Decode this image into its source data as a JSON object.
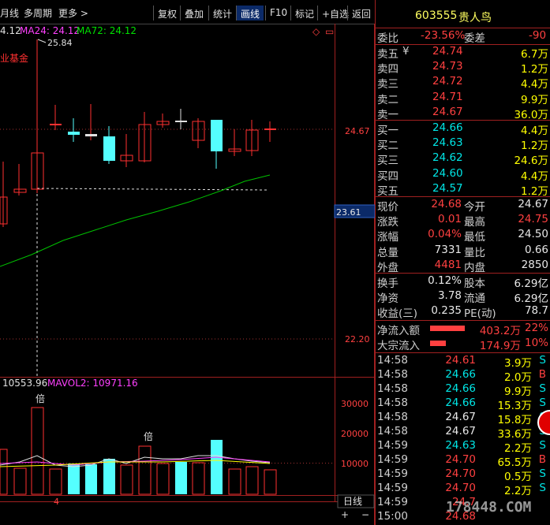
{
  "toolbar": {
    "period_partial": "月线",
    "multi_period": "多周期",
    "more": "更多 >",
    "buttons": [
      "复权",
      "叠加",
      "统计",
      "画线",
      "F10",
      "标记",
      "+自选",
      "返回"
    ],
    "active_button": "画线"
  },
  "chart": {
    "ma_legend": {
      "first_partial": "4.12",
      "ma24": "MA24: 24.12",
      "ma72": "MA72: 24.12"
    },
    "high_marker": "25.84",
    "left_text_partial": "业基金",
    "price_labels": {
      "right_price": "24.67",
      "ma_value_box": "23.61",
      "low_tick": "22.20"
    },
    "volume": {
      "legend_partial": "10553.96",
      "mavol2": "MAVOL2: 10971.16",
      "y_ticks": [
        "30000",
        "20000",
        "10000"
      ],
      "bei_label": "倍"
    },
    "bottom": {
      "axis_label": "4",
      "period_button": "日线"
    },
    "colors": {
      "up": "#ff3030",
      "down": "#54ffff",
      "ma_green": "#00c000",
      "ma_white": "#e0e0e0",
      "ma_yellow": "#ffff00"
    }
  },
  "quote": {
    "header": {
      "code": "603555",
      "name": "贵人鸟"
    },
    "weibi": {
      "label": "委比",
      "value": "-23.56%",
      "label2": "委差",
      "value2": "-90"
    },
    "asks": [
      {
        "label": "卖五",
        "mark": "¥",
        "price": "24.74",
        "vol": "6.7万"
      },
      {
        "label": "卖四",
        "mark": "",
        "price": "24.73",
        "vol": "1.2万"
      },
      {
        "label": "卖三",
        "mark": "",
        "price": "24.72",
        "vol": "4.4万"
      },
      {
        "label": "卖二",
        "mark": "",
        "price": "24.71",
        "vol": "9.9万"
      },
      {
        "label": "卖一",
        "mark": "",
        "price": "24.67",
        "vol": "36.0万"
      }
    ],
    "bids": [
      {
        "label": "买一",
        "price": "24.66",
        "vol": "4.4万"
      },
      {
        "label": "买二",
        "price": "24.63",
        "vol": "1.2万"
      },
      {
        "label": "买三",
        "price": "24.62",
        "vol": "24.6万"
      },
      {
        "label": "买四",
        "price": "24.60",
        "vol": "4.4万"
      },
      {
        "label": "买五",
        "price": "24.57",
        "vol": "1.2万"
      }
    ],
    "stats1": [
      {
        "l1": "现价",
        "v1": "24.68",
        "c1": "red",
        "l2": "今开",
        "v2": "24.67",
        "c2": "white"
      },
      {
        "l1": "涨跌",
        "v1": "0.01",
        "c1": "red",
        "l2": "最高",
        "v2": "24.75",
        "c2": "red"
      },
      {
        "l1": "涨幅",
        "v1": "0.04%",
        "c1": "red",
        "l2": "最低",
        "v2": "24.50",
        "c2": "white"
      },
      {
        "l1": "总量",
        "v1": "7331",
        "c1": "white",
        "l2": "量比",
        "v2": "0.66",
        "c2": "white"
      },
      {
        "l1": "外盘",
        "v1": "4481",
        "c1": "red",
        "l2": "内盘",
        "v2": "2850",
        "c2": "white"
      }
    ],
    "stats2": [
      {
        "l1": "换手",
        "v1": "0.12%",
        "l2": "股本",
        "v2": "6.29亿"
      },
      {
        "l1": "净资",
        "v1": "3.78",
        "l2": "流通",
        "v2": "6.29亿"
      },
      {
        "l1": "收益(三)",
        "v1": "0.235",
        "l2": "PE(动)",
        "v2": "78.7"
      }
    ],
    "flows": [
      {
        "label": "净流入额",
        "value": "403.2万",
        "pct": "22%",
        "bar_ratio": 1.0
      },
      {
        "label": "大宗流入",
        "value": "174.9万",
        "pct": "10%",
        "bar_ratio": 0.45
      }
    ],
    "ticks": [
      {
        "time": "14:58",
        "price": "24.61",
        "pc": "red",
        "vol": "3.9万",
        "flag": "S"
      },
      {
        "time": "14:58",
        "price": "24.66",
        "pc": "green",
        "vol": "2.0万",
        "flag": "B"
      },
      {
        "time": "14:58",
        "price": "24.66",
        "pc": "green",
        "vol": "9.9万",
        "flag": "S"
      },
      {
        "time": "14:58",
        "price": "24.66",
        "pc": "green",
        "vol": "15.3万",
        "flag": "S"
      },
      {
        "time": "14:58",
        "price": "24.67",
        "pc": "white",
        "vol": "15.8万",
        "flag": "S"
      },
      {
        "time": "14:58",
        "price": "24.67",
        "pc": "white",
        "vol": "33.6万",
        "flag": "S"
      },
      {
        "time": "14:59",
        "price": "24.63",
        "pc": "green",
        "vol": "2.2万",
        "flag": "S"
      },
      {
        "time": "14:59",
        "price": "24.70",
        "pc": "red",
        "vol": "65.5万",
        "flag": "B"
      },
      {
        "time": "14:59",
        "price": "24.70",
        "pc": "red",
        "vol": "0.5万",
        "flag": "S"
      },
      {
        "time": "14:59",
        "price": "24.70",
        "pc": "red",
        "vol": "2.2万",
        "flag": "S"
      },
      {
        "time": "14:59",
        "price": "24.7",
        "pc": "red",
        "vol": "",
        "flag": ""
      },
      {
        "time": "15:00",
        "price": "24.68",
        "pc": "red",
        "vol": "",
        "flag": ""
      }
    ],
    "watermark": "178448.COM"
  }
}
